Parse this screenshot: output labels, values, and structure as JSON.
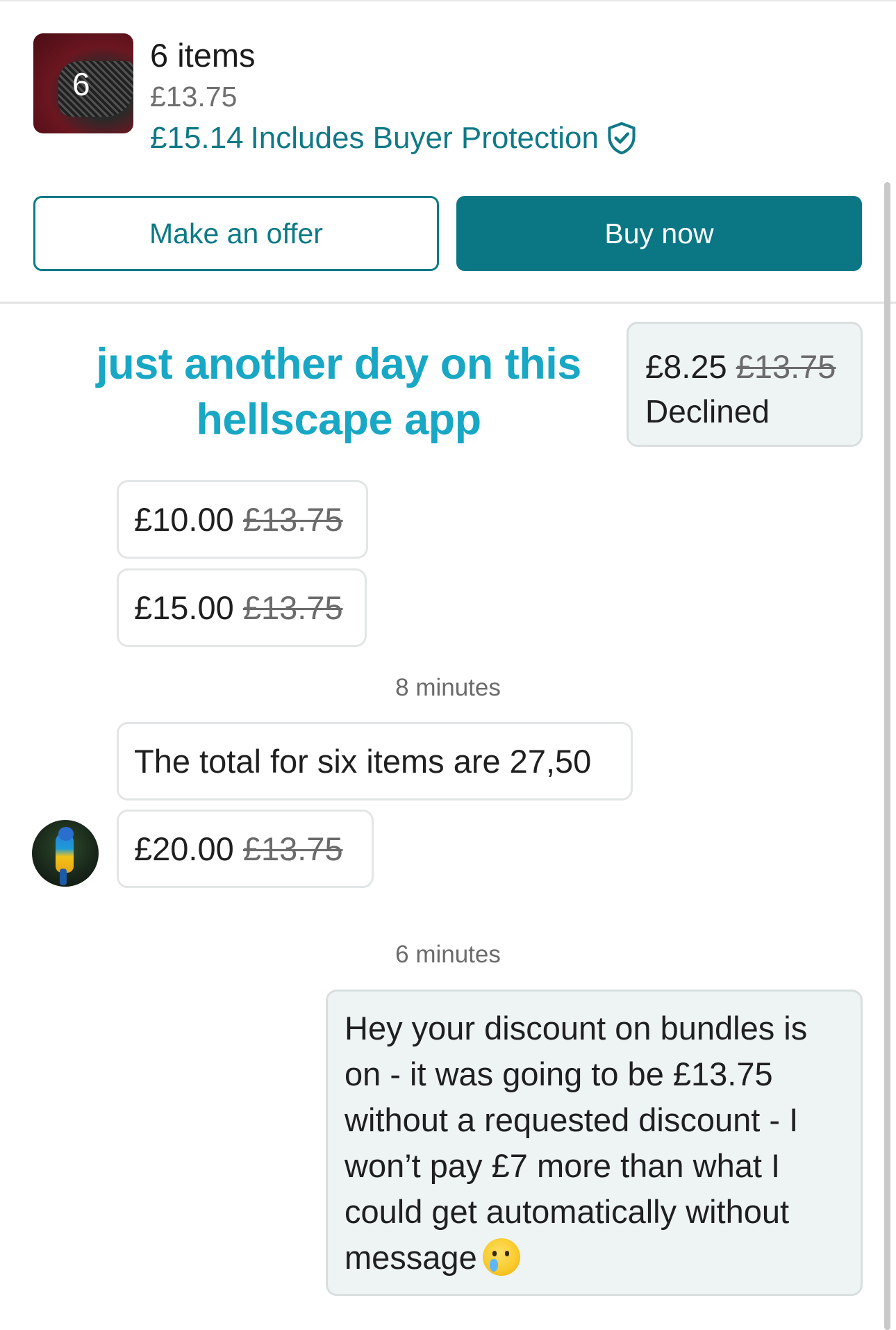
{
  "listing": {
    "thumbnail_count": "6",
    "title": "6 items",
    "price": "£13.75",
    "total_price": "£15.14",
    "protection_label": "Includes Buyer Protection",
    "protection_icon": "shield-check-icon"
  },
  "actions": {
    "offer_label": "Make an offer",
    "buy_label": "Buy now"
  },
  "caption": {
    "line1": "just another day on this",
    "line2": "hellscape app"
  },
  "messages": {
    "declined_offer": {
      "amount": "£8.25",
      "original": "£13.75",
      "status": "Declined"
    },
    "offer_1": {
      "amount": "£10.00",
      "original": "£13.75"
    },
    "offer_2": {
      "amount": "£15.00",
      "original": "£13.75"
    },
    "time_1": "8 minutes",
    "seller_text": "The total for six items are 27,50",
    "offer_3": {
      "amount": "£20.00",
      "original": "£13.75"
    },
    "time_2": "6 minutes",
    "buyer_text": "Hey your discount on bundles is on - it was going to be £13.75 without a requested discount - I won’t pay £7 more than what I could get automatically without message",
    "buyer_emoji": "crying-face-emoji"
  },
  "colors": {
    "accent": "#0b7785",
    "caption": "#18a7c4",
    "bubble_grey": "#eef3f3"
  }
}
